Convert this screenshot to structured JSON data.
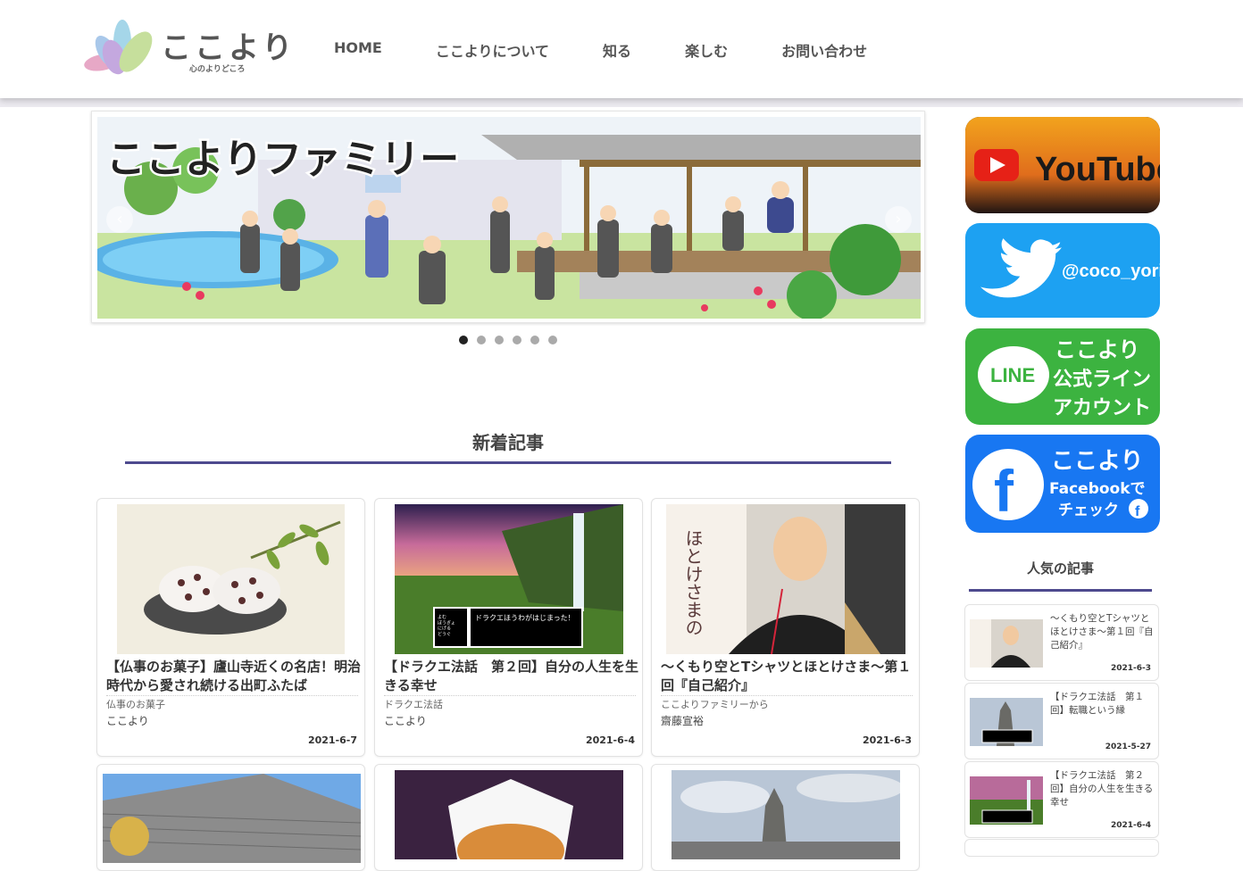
{
  "header": {
    "logo_text": "ここより",
    "logo_sub": "心のよりどころ",
    "nav": [
      "HOME",
      "ここよりについて",
      "知る",
      "楽しむ",
      "お問い合わせ"
    ]
  },
  "slider": {
    "banner_text": "ここよりファミリー",
    "prev": "‹",
    "next": "›",
    "dots": 6,
    "active_dot": 0
  },
  "latest": {
    "heading": "新着記事",
    "cards": [
      {
        "title": "【仏事のお菓子】廬山寺近くの名店！明治時代から愛され続ける出町ふたば",
        "category": "仏事のお菓子",
        "author": "ここより",
        "date": "2021-6-7"
      },
      {
        "title": "【ドラクエ法話　第２回】自分の人生を生きる幸せ",
        "category": "ドラクエ法話",
        "author": "ここより",
        "date": "2021-6-4",
        "game_text": "ドラクエほうわがはじまった！",
        "menu": "よむ\nぼうぎょ\nにげる\nどうぐ"
      },
      {
        "title": "〜くもり空とTシャツとほとけさま〜第１回『自己紹介』",
        "category": "ここよりファミリーから",
        "author": "齋藤宣裕",
        "date": "2021-6-3",
        "sign_text": "ほとけさまの\nやさしい精進"
      }
    ]
  },
  "sidebar": {
    "youtube": "YouTube",
    "twitter_handle": "@coco_yori",
    "line": {
      "badge": "LINE",
      "text1": "ここより",
      "text2": "公式ライン",
      "text3": "アカウント"
    },
    "facebook": {
      "text1": "ここより",
      "text2": "Facebookで",
      "text3": "チェック"
    },
    "popular_heading": "人気の記事",
    "popular": [
      {
        "title": "〜くもり空とTシャツとほとけさま〜第１回『自己紹介』",
        "date": "2021-6-3"
      },
      {
        "title": "【ドラクエ法話　第１回】転職という縁",
        "date": "2021-5-27"
      },
      {
        "title": "【ドラクエ法話　第２回】自分の人生を生きる幸せ",
        "date": "2021-6-4"
      }
    ]
  },
  "colors": {
    "accent": "#4e4a8e",
    "twitter": "#1da1f2",
    "line": "#3cb340",
    "facebook": "#1877f2"
  }
}
